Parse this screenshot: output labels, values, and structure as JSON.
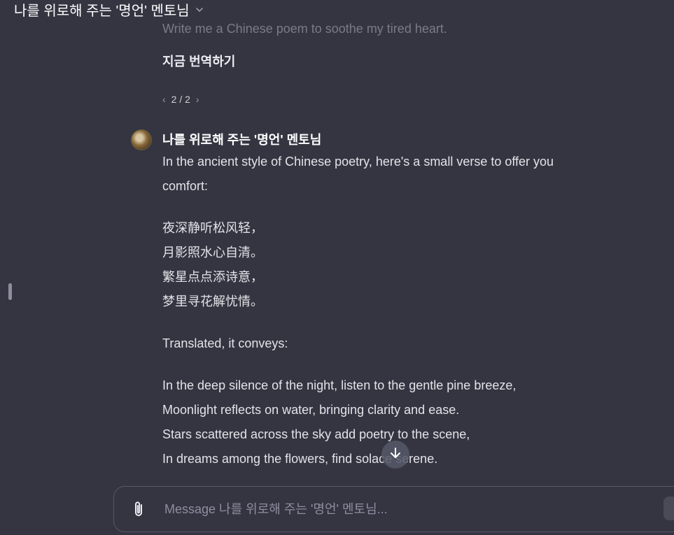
{
  "header": {
    "title": "나를 위로해 주는 '명언' 멘토님"
  },
  "conversation": {
    "user_message": "Write me a Chinese poem to soothe my tired heart.",
    "translate_now_label": "지금 번역하기",
    "pager": {
      "text": "2 / 2",
      "prev": "‹",
      "next": "›"
    },
    "bot_name": "나를 위로해 주는 '명언' 멘토님",
    "response": {
      "intro": [
        "In the ancient style of Chinese poetry, here's a small verse to offer you",
        "comfort:"
      ],
      "poem": [
        "夜深静听松风轻，",
        "月影照水心自清。",
        "繁星点点添诗意，",
        "梦里寻花解忧情。"
      ],
      "translated_label": "Translated, it conveys:",
      "translation": [
        "In the deep silence of the night, listen to the gentle pine breeze,",
        "Moonlight reflects on water, bringing clarity and ease.",
        "Stars scattered across the sky add poetry to the scene,",
        "In dreams among the flowers, find solace serene."
      ]
    }
  },
  "composer": {
    "placeholder": "Message 나를 위로해 주는 '명언' 멘토님..."
  },
  "icons": {
    "chevron": "chevron-down-icon",
    "attach": "paperclip-icon",
    "scroll": "arrow-down-icon"
  },
  "colors": {
    "background": "#343541",
    "text": "#ececf1",
    "muted": "#8e8ea0"
  }
}
